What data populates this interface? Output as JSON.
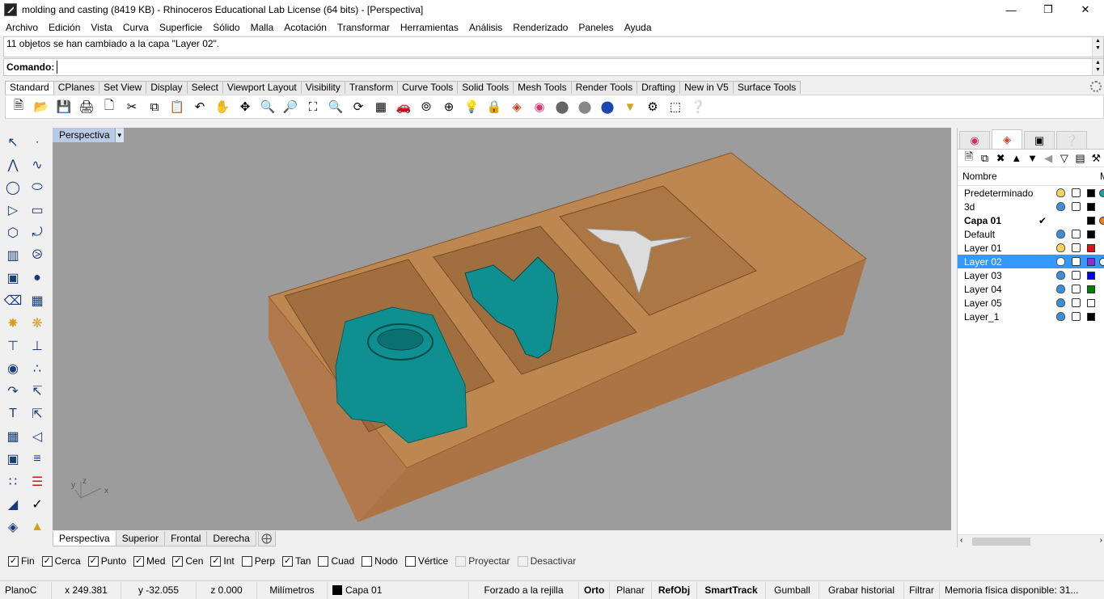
{
  "window": {
    "title": "molding and casting (8419 KB) - Rhinoceros Educational Lab License (64 bits) - [Perspectiva]"
  },
  "menu": [
    "Archivo",
    "Edición",
    "Vista",
    "Curva",
    "Superficie",
    "Sólido",
    "Malla",
    "Acotación",
    "Transformar",
    "Herramientas",
    "Análisis",
    "Renderizado",
    "Paneles",
    "Ayuda"
  ],
  "history": {
    "text": "11 objetos se han cambiado a la capa \"Layer 02\"."
  },
  "command": {
    "label": "Comando:",
    "value": ""
  },
  "toolbar_tabs": [
    "Standard",
    "CPlanes",
    "Set View",
    "Display",
    "Select",
    "Viewport Layout",
    "Visibility",
    "Transform",
    "Curve Tools",
    "Solid Tools",
    "Mesh Tools",
    "Render Tools",
    "Drafting",
    "New in V5",
    "Surface Tools"
  ],
  "toolbar_icons": [
    "new-file-icon",
    "open-folder-icon",
    "save-icon",
    "print-icon",
    "import-icon",
    "cut-icon",
    "copy-icon",
    "paste-icon",
    "undo-icon",
    "pan-hand-icon",
    "rotate-view-icon",
    "zoom-icon",
    "zoom-window-icon",
    "zoom-extents-icon",
    "zoom-selected-icon",
    "rotate-camera-icon",
    "four-viewports-icon",
    "car-icon",
    "camera-target-icon",
    "cplane-icon",
    "lightbulb-icon",
    "lock-icon",
    "layer-icon",
    "color-wheel-icon",
    "shaded-sphere-icon",
    "render-sphere-icon",
    "blue-sphere-icon",
    "filter-icon",
    "gear-options-icon",
    "selection-icon",
    "help-icon"
  ],
  "viewport": {
    "title": "Perspectiva",
    "axis_x": "x",
    "axis_y": "y",
    "axis_z": "z"
  },
  "view_tabs": [
    "Perspectiva",
    "Superior",
    "Frontal",
    "Derecha"
  ],
  "layers_panel": {
    "header": "Nombre",
    "header_extra": "M",
    "layers": [
      {
        "name": "Predeterminado",
        "current": false,
        "bold": false,
        "bulb": "#f4d35e",
        "color": "#000000",
        "material": "#20a0a0",
        "selected": false
      },
      {
        "name": "3d",
        "current": false,
        "bold": false,
        "bulb": "#3a8fd8",
        "color": "#000000",
        "material": "",
        "selected": false
      },
      {
        "name": "Capa 01",
        "current": true,
        "bold": true,
        "bulb": "",
        "color": "#000000",
        "material": "#f08020",
        "selected": false
      },
      {
        "name": "Default",
        "current": false,
        "bold": false,
        "bulb": "#3a8fd8",
        "color": "#000000",
        "material": "",
        "selected": false
      },
      {
        "name": "Layer 01",
        "current": false,
        "bold": false,
        "bulb": "#f4d35e",
        "color": "#e01010",
        "material": "",
        "selected": false
      },
      {
        "name": "Layer 02",
        "current": false,
        "bold": false,
        "bulb": "#ffffff",
        "color": "#8a2be2",
        "material": "#ffffff",
        "selected": true
      },
      {
        "name": "Layer 03",
        "current": false,
        "bold": false,
        "bulb": "#3a8fd8",
        "color": "#0000ff",
        "material": "",
        "selected": false
      },
      {
        "name": "Layer 04",
        "current": false,
        "bold": false,
        "bulb": "#3a8fd8",
        "color": "#008000",
        "material": "",
        "selected": false
      },
      {
        "name": "Layer 05",
        "current": false,
        "bold": false,
        "bulb": "#3a8fd8",
        "color": "#ffffff",
        "material": "",
        "selected": false
      },
      {
        "name": "Layer_1",
        "current": false,
        "bold": false,
        "bulb": "#3a8fd8",
        "color": "#000000",
        "material": "",
        "selected": false
      }
    ]
  },
  "osnaps": [
    {
      "label": "Fin",
      "checked": true,
      "enabled": true
    },
    {
      "label": "Cerca",
      "checked": true,
      "enabled": true
    },
    {
      "label": "Punto",
      "checked": true,
      "enabled": true
    },
    {
      "label": "Med",
      "checked": true,
      "enabled": true
    },
    {
      "label": "Cen",
      "checked": true,
      "enabled": true
    },
    {
      "label": "Int",
      "checked": true,
      "enabled": true
    },
    {
      "label": "Perp",
      "checked": false,
      "enabled": true
    },
    {
      "label": "Tan",
      "checked": true,
      "enabled": true
    },
    {
      "label": "Cuad",
      "checked": false,
      "enabled": true
    },
    {
      "label": "Nodo",
      "checked": false,
      "enabled": true
    },
    {
      "label": "Vértice",
      "checked": false,
      "enabled": true
    },
    {
      "label": "Proyectar",
      "checked": false,
      "enabled": false
    },
    {
      "label": "Desactivar",
      "checked": false,
      "enabled": false
    }
  ],
  "status": {
    "cplane": "PlanoC",
    "x": "x 249.381",
    "y": "y -32.055",
    "z": "z 0.000",
    "units": "Milímetros",
    "layer": "Capa 01",
    "grid_snap": "Forzado a la rejilla",
    "ortho": "Orto",
    "planar": "Planar",
    "osnap": "RefObj",
    "smarttrack": "SmartTrack",
    "gumball": "Gumball",
    "record_history": "Grabar historial",
    "filter": "Filtrar",
    "memory": "Memoria física disponible: 31..."
  },
  "colors": {
    "viewport_bg": "#9c9c9c",
    "mold_box": "#c8803a",
    "parts": "#0f8f8f",
    "dragonfly": "#dcdcdc",
    "selection": "#3399ff"
  }
}
